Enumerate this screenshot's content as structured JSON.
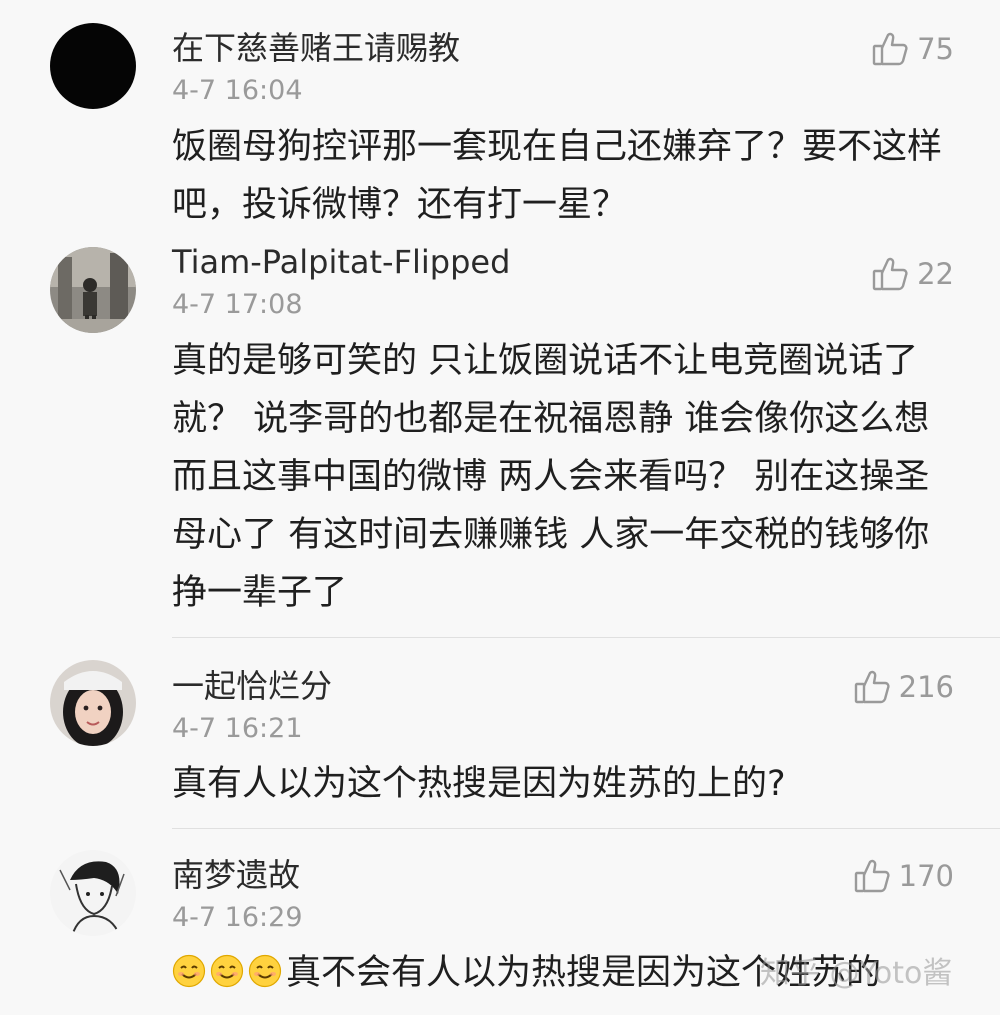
{
  "comments": [
    {
      "username": "在下慈善赌王请赐教",
      "time": "4-7 16:04",
      "likes": "75",
      "text": "饭圈母狗控评那一套现在自己还嫌弃了？要不这样吧，投诉微博？还有打一星？"
    },
    {
      "username": "Tiam-Palpitat-Flipped",
      "time": "4-7 17:08",
      "likes": "22",
      "text": "真的是够可笑的 只让饭圈说话不让电竞圈说话了就？ 说李哥的也都是在祝福恩静 谁会像你这么想 而且这事中国的微博 两人会来看吗？ 别在这操圣母心了 有这时间去赚赚钱 人家一年交税的钱够你挣一辈子了"
    },
    {
      "username": "一起恰烂分",
      "time": "4-7 16:21",
      "likes": "216",
      "text": "真有人以为这个热搜是因为姓苏的上的?"
    },
    {
      "username": "南梦遗故",
      "time": "4-7 16:29",
      "likes": "170",
      "text": "真不会有人以为热搜是因为这个姓苏的"
    }
  ],
  "icons": {
    "like": "thumbs-up-icon",
    "emoji": "smiling-face-icon"
  },
  "watermark": "知乎 @Yoto酱"
}
